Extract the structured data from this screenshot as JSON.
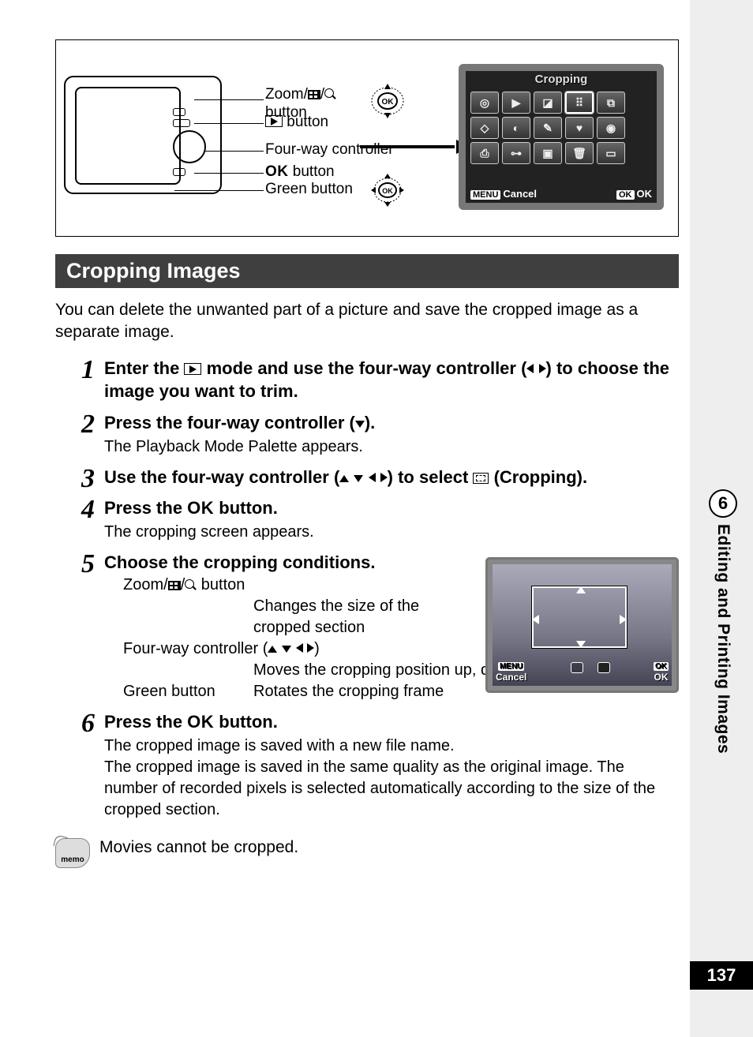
{
  "sidebar": {
    "chapter_number": "6",
    "chapter_title": "Editing and Printing Images",
    "page_number": "137"
  },
  "diagram": {
    "labels": {
      "zoom": "Zoom/",
      "zoom_suffix": " button",
      "playback_button": " button",
      "fourway": "Four-way controller",
      "ok_label": "OK",
      "ok_suffix": " button",
      "green": "Green button"
    },
    "screen": {
      "title": "Cropping",
      "menu_label": "MENU",
      "cancel": "Cancel",
      "ok_tag": "OK",
      "ok_label": "OK"
    }
  },
  "section_title": "Cropping Images",
  "intro": "You can delete the unwanted part of a picture and save the cropped image as a separate image.",
  "steps": {
    "s1": {
      "num": "1",
      "head_a": "Enter the ",
      "head_b": " mode and use the four-way controller (",
      "head_c": ") to choose the image you want to trim."
    },
    "s2": {
      "num": "2",
      "head_a": "Press the four-way controller (",
      "head_b": ").",
      "sub": "The Playback Mode Palette appears."
    },
    "s3": {
      "num": "3",
      "head_a": "Use the four-way controller (",
      "head_b": ") to select ",
      "head_c": " (Cropping)."
    },
    "s4": {
      "num": "4",
      "head_a": "Press the ",
      "ok": "OK",
      "head_b": " button.",
      "sub": "The cropping screen appears."
    },
    "s5": {
      "num": "5",
      "head": "Choose the cropping conditions.",
      "row1_label_a": "Zoom/",
      "row1_label_b": " button",
      "row1_desc": "Changes the size of the cropped section",
      "row2_label_a": "Four-way controller (",
      "row2_label_b": ")",
      "row2_desc": "Moves the cropping position up, down, left and right",
      "row3_label": "Green button",
      "row3_desc": "Rotates the cropping frame"
    },
    "s6": {
      "num": "6",
      "head_a": "Press the ",
      "ok": "OK",
      "head_b": " button.",
      "sub": "The cropped image is saved with a new file name.\nThe cropped image is saved in the same quality as the original image. The number of recorded pixels is selected automatically according to the size of the cropped section."
    }
  },
  "crop_screen": {
    "menu": "MENU",
    "cancel": "Cancel",
    "ok_tag": "OK",
    "ok": "OK"
  },
  "memo": {
    "icon_text": "memo",
    "text": "Movies cannot be cropped."
  }
}
